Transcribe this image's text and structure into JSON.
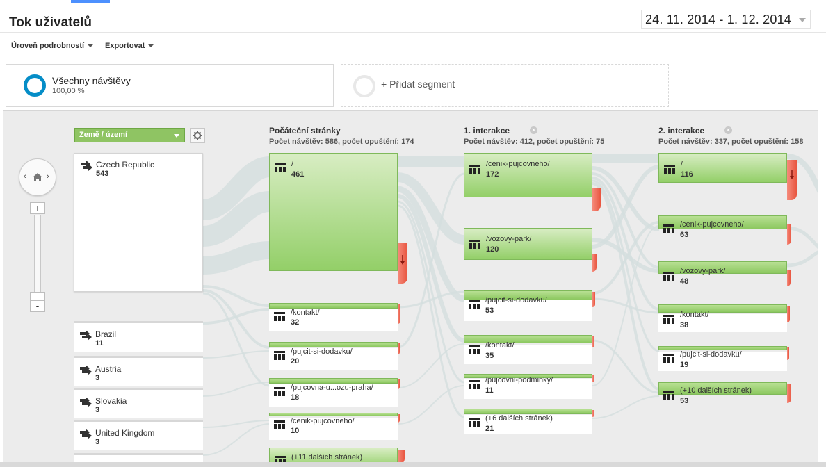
{
  "page": {
    "title": "Tok uživatelů",
    "date_range": "24. 11. 2014 - 1. 12. 2014"
  },
  "toolbar": {
    "detail_level": "Úroveň podrobností",
    "export": "Exportovat"
  },
  "segments": {
    "active_label": "Všechny návštěvy",
    "active_pct": "100,00 %",
    "add_label": "+ Přidat segment"
  },
  "flow": {
    "dimension": "Země / území",
    "countries": [
      {
        "name": "Czech Republic",
        "count": "543"
      },
      {
        "name": "Brazil",
        "count": "11"
      },
      {
        "name": "Austria",
        "count": "3"
      },
      {
        "name": "Slovakia",
        "count": "3"
      },
      {
        "name": "United Kingdom",
        "count": "3"
      }
    ],
    "columns": [
      {
        "title": "Počáteční stránky",
        "summary": "Počet návštěv: 586, počet opuštění: 174",
        "nodes": [
          {
            "label": "/",
            "count": "461"
          },
          {
            "label": "/kontakt/",
            "count": "32"
          },
          {
            "label": "/pujcit-si-dodavku/",
            "count": "20"
          },
          {
            "label": "/pujcovna-u...ozu-praha/",
            "count": "18"
          },
          {
            "label": "/cenik-pujcovneho/",
            "count": "10"
          },
          {
            "label": "(+11 dalších stránek)",
            "count": ""
          }
        ]
      },
      {
        "title": "1. interakce",
        "summary": "Počet návštěv: 412, počet opuštění: 75",
        "nodes": [
          {
            "label": "/cenik-pujcovneho/",
            "count": "172"
          },
          {
            "label": "/vozovy-park/",
            "count": "120"
          },
          {
            "label": "/pujcit-si-dodavku/",
            "count": "53"
          },
          {
            "label": "/kontakt/",
            "count": "35"
          },
          {
            "label": "/pujcovni-podminky/",
            "count": "11"
          },
          {
            "label": "(+6 dalších stránek)",
            "count": "21"
          }
        ]
      },
      {
        "title": "2. interakce",
        "summary": "Počet návštěv: 337, počet opuštění: 158",
        "nodes": [
          {
            "label": "/",
            "count": "116"
          },
          {
            "label": "/cenik-pujcovneho/",
            "count": "63"
          },
          {
            "label": "/vozovy-park/",
            "count": "48"
          },
          {
            "label": "/kontakt/",
            "count": "38"
          },
          {
            "label": "/pujcit-si-dodavku/",
            "count": "19"
          },
          {
            "label": "(+10 dalších stránek)",
            "count": "53"
          }
        ]
      }
    ]
  },
  "icons": {
    "segment": "donut-ring-icon",
    "gear": "gear-icon",
    "home": "home-icon",
    "country": "country-arrow-icon",
    "page": "page-layout-icon",
    "close": "close-icon",
    "exit": "exit-arrow-icon"
  },
  "colors": {
    "node_green": "#93cf68",
    "exit_red": "#e8553f",
    "segment_blue": "#058dc7",
    "accent_blue": "#4d90fe"
  }
}
